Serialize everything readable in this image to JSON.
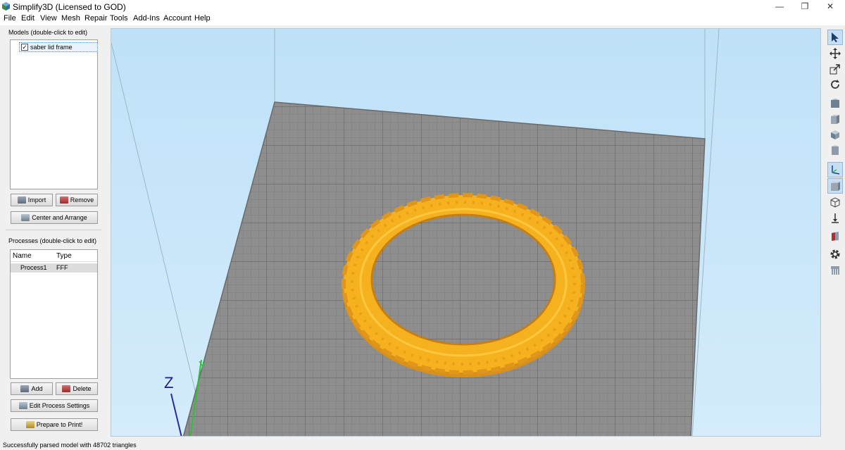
{
  "window": {
    "title": "Simplify3D (Licensed to GOD)",
    "minimize": "—",
    "maximize": "❐",
    "close": "✕"
  },
  "menu": [
    "File",
    "Edit",
    "View",
    "Mesh",
    "Repair",
    "Tools",
    "Add-Ins",
    "Account",
    "Help"
  ],
  "models": {
    "label": "Models (double-click to edit)",
    "items": [
      {
        "name": "saber lid frame",
        "checked": true
      }
    ],
    "import_label": "Import",
    "remove_label": "Remove",
    "center_label": "Center and Arrange"
  },
  "processes": {
    "label": "Processes (double-click to edit)",
    "columns": [
      "Name",
      "Type"
    ],
    "rows": [
      {
        "name": "Process1",
        "type": "FFF"
      }
    ],
    "add_label": "Add",
    "delete_label": "Delete",
    "edit_label": "Edit Process Settings",
    "prepare_label": "Prepare to Print!"
  },
  "viewport": {
    "axis_z": "Z",
    "axis_y": "Y",
    "model_color": "#f6b21e",
    "bed_color": "#8e8e8e"
  },
  "status": "Successfully parsed model with 48702 triangles",
  "colors": {
    "accent": "#c6dff5",
    "sky": "#c8e6fa"
  }
}
